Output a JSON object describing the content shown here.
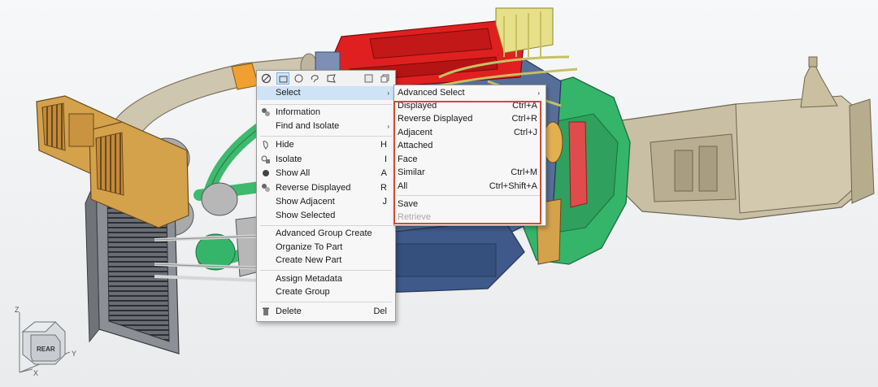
{
  "context_menu": {
    "toolbar": [
      {
        "icon": "no-entry-icon"
      },
      {
        "icon": "rectangle-select-icon",
        "active": true
      },
      {
        "icon": "circle-select-icon"
      },
      {
        "icon": "lasso-select-icon"
      },
      {
        "icon": "polygon-select-icon"
      },
      {
        "icon": "window-icon"
      },
      {
        "icon": "copy-window-icon"
      }
    ],
    "items": [
      {
        "label": "Select",
        "submenu": true,
        "highlighted": true
      },
      {
        "label": "Information",
        "icon": "info-icon"
      },
      {
        "label": "Find and Isolate",
        "submenu": true
      },
      {
        "label": "Hide",
        "key": "H",
        "icon": "hide-icon"
      },
      {
        "label": "Isolate",
        "key": "I",
        "icon": "isolate-icon"
      },
      {
        "label": "Show All",
        "key": "A",
        "icon": "show-all-icon"
      },
      {
        "label": "Reverse Displayed",
        "key": "R",
        "icon": "reverse-displayed-icon"
      },
      {
        "label": "Show Adjacent",
        "key": "J"
      },
      {
        "label": "Show Selected"
      },
      {
        "label": "Advanced Group Create"
      },
      {
        "label": "Organize To Part"
      },
      {
        "label": "Create New Part"
      },
      {
        "label": "Assign Metadata"
      },
      {
        "label": "Create Group"
      },
      {
        "label": "Delete",
        "key": "Del",
        "icon": "trash-icon"
      }
    ],
    "submenu_arrow": "›"
  },
  "select_submenu": {
    "items": [
      {
        "label": "Advanced Select",
        "submenu": true
      },
      {
        "label": "Displayed",
        "key": "Ctrl+A"
      },
      {
        "label": "Reverse Displayed",
        "key": "Ctrl+R"
      },
      {
        "label": "Adjacent",
        "key": "Ctrl+J"
      },
      {
        "label": "Attached"
      },
      {
        "label": "Face"
      },
      {
        "label": "Similar",
        "key": "Ctrl+M"
      },
      {
        "label": "All",
        "key": "Ctrl+Shift+A"
      },
      {
        "label": "Save"
      },
      {
        "label": "Retrieve",
        "disabled": true
      }
    ],
    "highlight_color": "#d8492f"
  },
  "view_cube": {
    "face_label": "REAR",
    "axes": {
      "z": "Z",
      "y": "Y",
      "x": "X"
    }
  },
  "model": {
    "colors": {
      "engine_block": "#3f5a8a",
      "valve_cover": "#e02020",
      "radiator_tank": "#d4a24a",
      "gearbox": "#c9bfa4",
      "bellhousing": "#35b56a",
      "hoses": "#3fb96d",
      "intake_pipe": "#cfc6b0",
      "fuel_lines": "#e6e08a"
    }
  }
}
